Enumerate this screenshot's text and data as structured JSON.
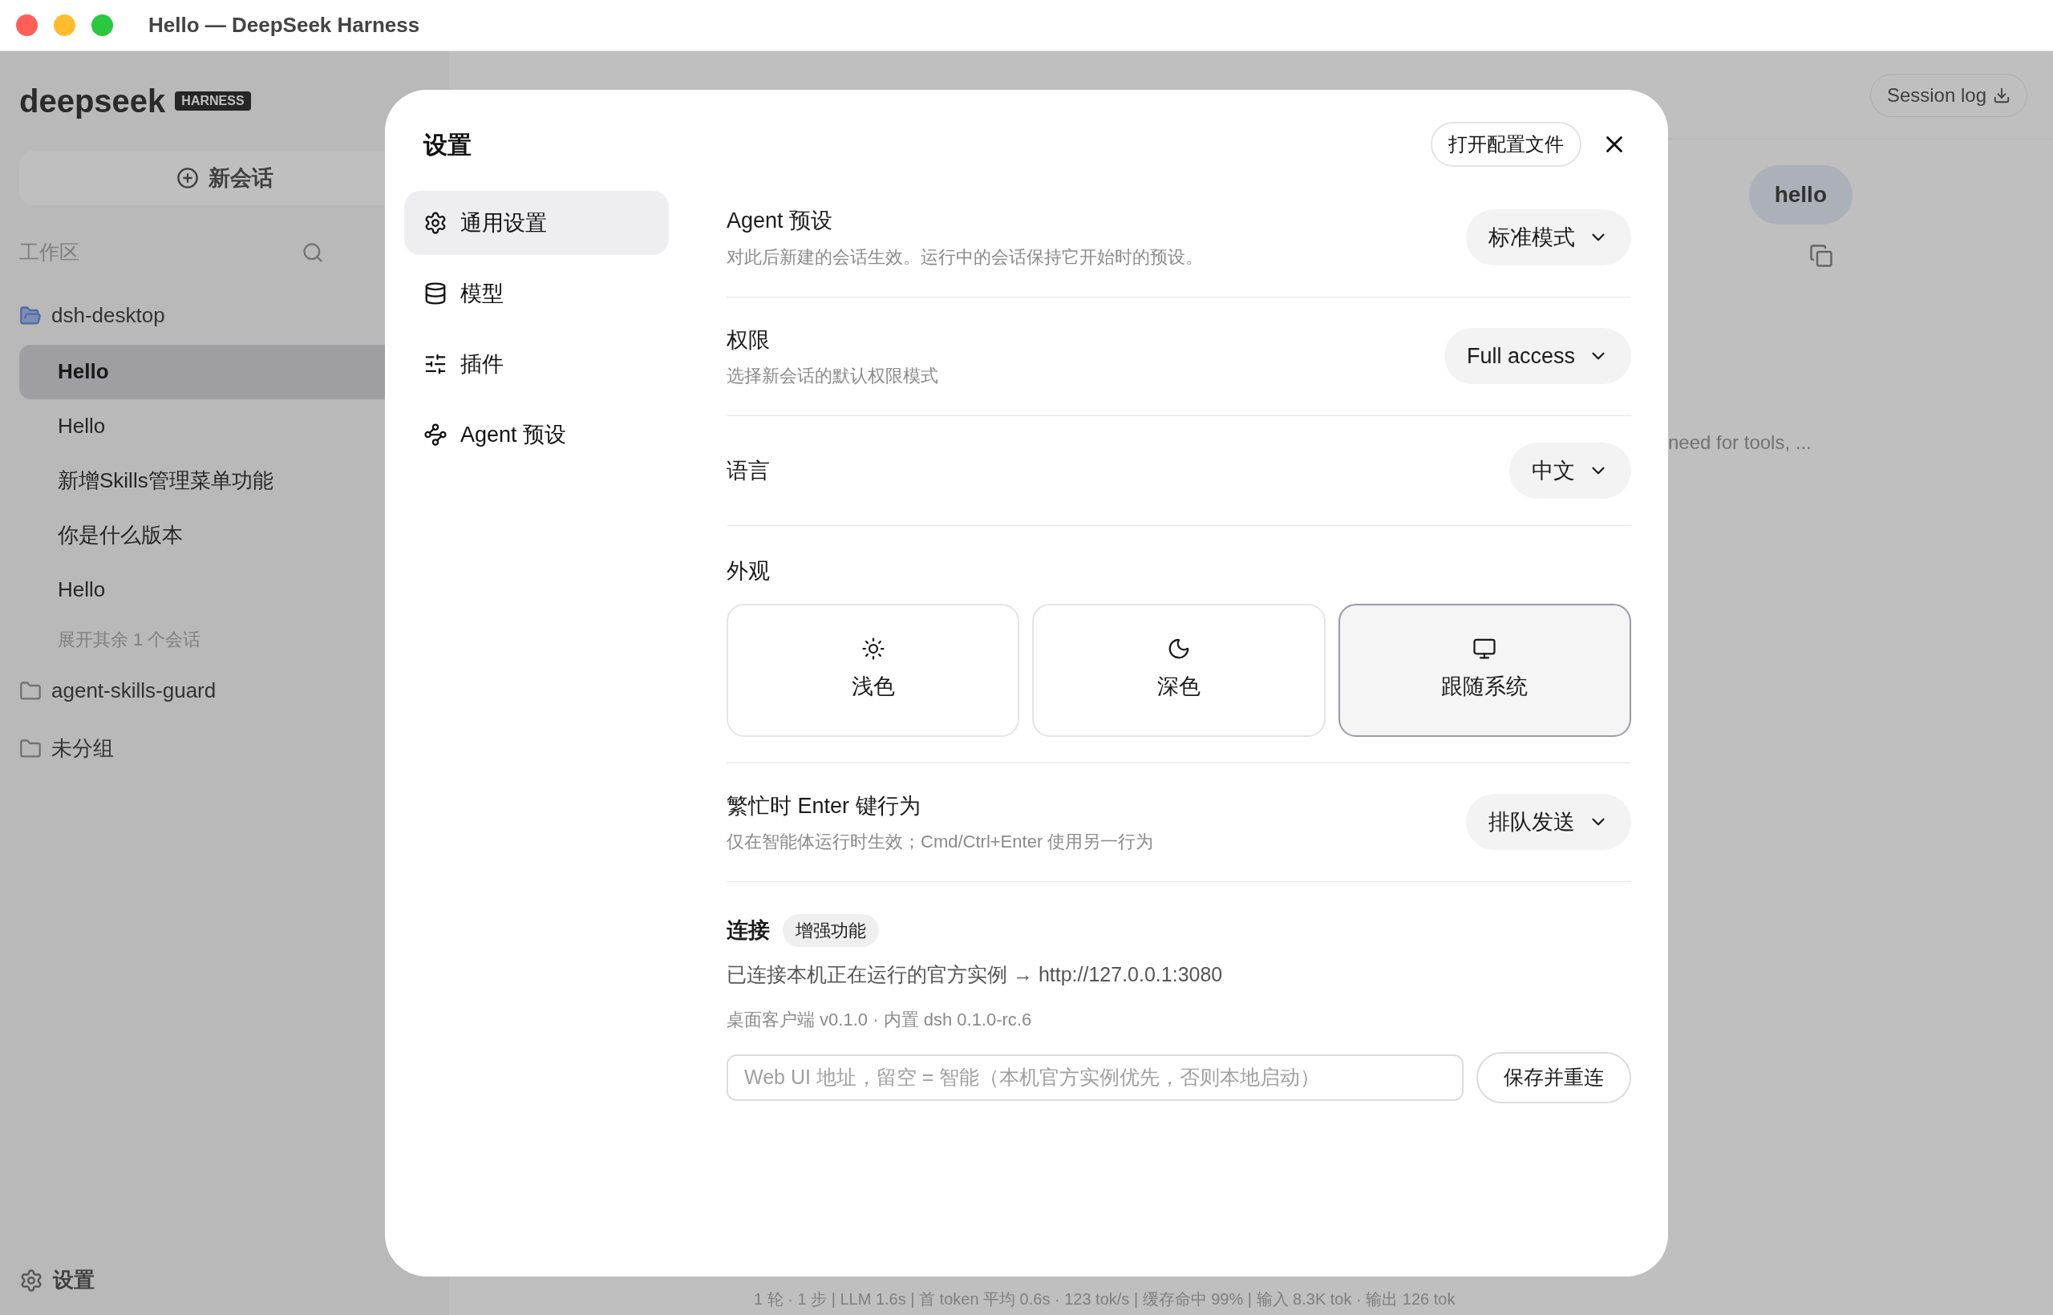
{
  "window": {
    "title": "Hello — DeepSeek Harness"
  },
  "background": {
    "logo": {
      "name": "deepseek",
      "badge": "HARNESS"
    },
    "new_chat": "新会话",
    "workspace_label": "工作区",
    "tree": [
      {
        "name": "dsh-desktop",
        "expanded": true,
        "children": [
          {
            "title": "Hello",
            "selected": true
          },
          {
            "title": "Hello",
            "selected": false
          },
          {
            "title": "新增Skills管理菜单功能",
            "selected": false
          },
          {
            "title": "你是什么版本",
            "selected": false
          },
          {
            "title": "Hello",
            "selected": false
          }
        ],
        "more": "展开其余 1 个会话"
      },
      {
        "name": "agent-skills-guard",
        "expanded": false
      },
      {
        "name": "未分组",
        "expanded": false
      }
    ],
    "settings_link": "设置",
    "session_log": "Session log",
    "user_message": "hello",
    "reply_fragment": "need for tools, ...",
    "status_bar": "1 轮 · 1 步 | LLM 1.6s | 首 token 平均 0.6s · 123 tok/s | 缓存命中 99% | 输入 8.3K tok · 输出 126 tok"
  },
  "settings": {
    "title": "设置",
    "open_config": "打开配置文件",
    "nav": [
      {
        "label": "通用设置",
        "selected": true
      },
      {
        "label": "模型",
        "selected": false
      },
      {
        "label": "插件",
        "selected": false
      },
      {
        "label": "Agent 预设",
        "selected": false
      }
    ],
    "rows": [
      {
        "kind": "select",
        "title": "Agent 预设",
        "description": "对此后新建的会话生效。运行中的会话保持它开始时的预设。",
        "value": "标准模式"
      },
      {
        "kind": "select",
        "title": "权限",
        "description": "选择新会话的默认权限模式",
        "value": "Full access"
      },
      {
        "kind": "select",
        "title": "语言",
        "value": "中文"
      },
      {
        "kind": "theme",
        "title": "外观",
        "options": [
          {
            "label": "浅色",
            "selected": false
          },
          {
            "label": "深色",
            "selected": false
          },
          {
            "label": "跟随系统",
            "selected": true
          }
        ]
      },
      {
        "kind": "select",
        "title": "繁忙时 Enter 键行为",
        "description": "仅在智能体运行时生效；Cmd/Ctrl+Enter 使用另一行为",
        "value": "排队发送"
      },
      {
        "kind": "connection",
        "title": "连接",
        "badge": "增强功能",
        "status": "已连接本机正在运行的官方实例 → http://127.0.0.1:3080",
        "version": "桌面客户端 v0.1.0 · 内置 dsh 0.1.0-rc.6",
        "placeholder": "Web UI 地址，留空 = 智能（本机官方实例优先，否则本地启动）",
        "button": "保存并重连"
      }
    ]
  }
}
